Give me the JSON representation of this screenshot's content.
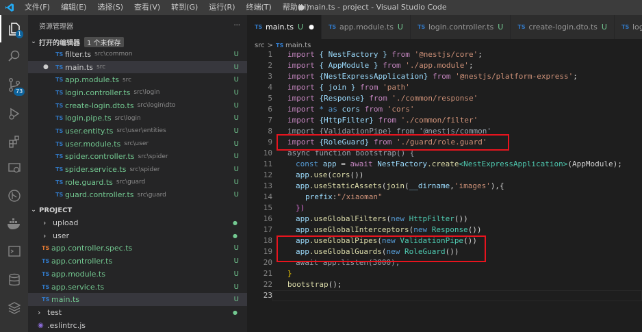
{
  "window": {
    "title": "● main.ts - project - Visual Studio Code",
    "menu": [
      "文件(F)",
      "编辑(E)",
      "选择(S)",
      "查看(V)",
      "转到(G)",
      "运行(R)",
      "终端(T)",
      "帮助(H)"
    ]
  },
  "activity": {
    "explorer_badge": "1",
    "scm_badge": "73"
  },
  "sidebar": {
    "title": "资源管理器",
    "more": "···",
    "open_editors": {
      "label": "打开的编辑器",
      "unsaved": "1 个未保存"
    },
    "open_files": [
      {
        "name": "filter.ts",
        "path": "src\\common",
        "status": "U"
      },
      {
        "name": "main.ts",
        "path": "src",
        "status": "U"
      },
      {
        "name": "app.module.ts",
        "path": "src",
        "status": "U"
      },
      {
        "name": "login.controller.ts",
        "path": "src\\login",
        "status": "U"
      },
      {
        "name": "create-login.dto.ts",
        "path": "src\\login\\dto",
        "status": "U"
      },
      {
        "name": "login.pipe.ts",
        "path": "src\\login",
        "status": "U"
      },
      {
        "name": "user.entity.ts",
        "path": "src\\user\\entities",
        "status": "U"
      },
      {
        "name": "user.module.ts",
        "path": "src\\user",
        "status": "U"
      },
      {
        "name": "spider.controller.ts",
        "path": "src\\spider",
        "status": "U"
      },
      {
        "name": "spider.service.ts",
        "path": "src\\spider",
        "status": "U"
      },
      {
        "name": "role.guard.ts",
        "path": "src\\guard",
        "status": "U"
      },
      {
        "name": "guard.controller.ts",
        "path": "src\\guard",
        "status": "U"
      }
    ],
    "project": {
      "label": "PROJECT",
      "items": [
        {
          "name": "upload",
          "status": "●"
        },
        {
          "name": "user",
          "status": "●"
        },
        {
          "name": "app.controller.spec.ts",
          "status": "U"
        },
        {
          "name": "app.controller.ts",
          "status": "U"
        },
        {
          "name": "app.module.ts",
          "status": "U"
        },
        {
          "name": "app.service.ts",
          "status": "U"
        },
        {
          "name": "main.ts",
          "status": "U"
        },
        {
          "name": "test",
          "status": "●"
        },
        {
          "name": ".eslintrc.js",
          "status": ""
        }
      ]
    }
  },
  "tabs": [
    {
      "label": "main.ts",
      "status": "U"
    },
    {
      "label": "app.module.ts",
      "status": "U"
    },
    {
      "label": "login.controller.ts",
      "status": "U"
    },
    {
      "label": "create-login.dto.ts",
      "status": "U"
    },
    {
      "label": "logi"
    }
  ],
  "breadcrumb": {
    "folder": "src",
    "file": "main.ts",
    "sep": ">"
  },
  "line_numbers": [
    "1",
    "2",
    "3",
    "4",
    "5",
    "6",
    "7",
    "8",
    "9",
    "10",
    "11",
    "12",
    "13",
    "14",
    "15",
    "16",
    "17",
    "18",
    "19",
    "20",
    "21",
    "22",
    "23"
  ],
  "code": {
    "l1": [
      "import",
      "{ NestFactory }",
      "from",
      "'@nestjs/core'",
      ";"
    ],
    "l2": [
      "import",
      "{ AppModule }",
      "from",
      "'./app.module'",
      ";"
    ],
    "l3": [
      "import",
      "{NestExpressApplication}",
      "from",
      "'@nestjs/platform-express'",
      ";"
    ],
    "l4": [
      "import",
      "{ join }",
      "from",
      "'path'"
    ],
    "l5": [
      "import",
      "{Response}",
      "from",
      "'./common/response'"
    ],
    "l6": [
      "import",
      "* as",
      "cors",
      "from",
      "'cors'"
    ],
    "l7": [
      "import",
      "{HttpFilter}",
      "from",
      "'./common/filter'"
    ],
    "l8": "import {ValidationPipe} from '@nestjs/common'",
    "l9": [
      "import",
      "{RoleGuard}",
      "from",
      "'./guard/role.guard'"
    ],
    "l10": "async function bootstrap() {",
    "l11": [
      "const",
      "app",
      "=",
      "await",
      "NestFactory",
      ".create",
      "<NestExpressApplication>",
      "(AppModule);"
    ],
    "l12": [
      "app",
      ".use",
      "(",
      "cors",
      "())"
    ],
    "l13": [
      "app",
      ".useStaticAssets",
      "(",
      "join",
      "(",
      "__dirname",
      ",",
      "'images'",
      "),{"
    ],
    "l14": [
      "prefix",
      ":",
      "\"/xiaoman\""
    ],
    "l15": "})",
    "l16": [
      "app",
      ".useGlobalFilters",
      "(",
      "new",
      "HttpFilter",
      "())"
    ],
    "l17": [
      "app",
      ".useGlobalInterceptors",
      "(",
      "new",
      "Response",
      "())"
    ],
    "l18": [
      "app",
      ".useGlobalPipes",
      "(",
      "new",
      "ValidationPipe",
      "())"
    ],
    "l19": [
      "app",
      ".useGlobalGuards",
      "(",
      "new",
      "RoleGuard",
      "())"
    ],
    "l20": "await app.listen(3000);",
    "l21": "}",
    "l22": [
      "bootstrap",
      "();"
    ]
  }
}
